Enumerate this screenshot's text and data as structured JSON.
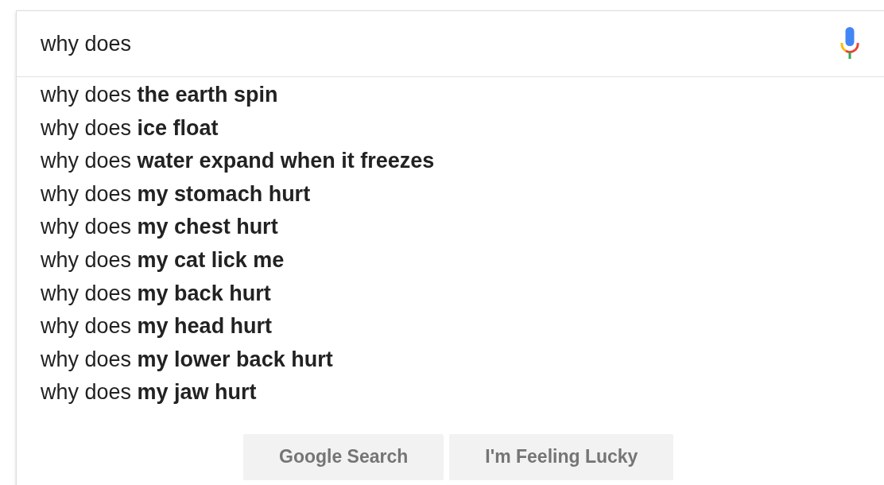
{
  "search": {
    "value": "why does"
  },
  "suggestions": [
    "why does **the earth spin**",
    "why does **ice float**",
    "why does **water expand when it freezes**",
    "why does **my stomach hurt**",
    "why does **my chest hurt**",
    "why does **my cat lick me**",
    "why does **my back hurt**",
    "why does **my head hurt**",
    "why does **my lower back hurt**",
    "why does **my jaw hurt**"
  ],
  "buttons": [
    "Google Search",
    "I'm Feeling Lucky"
  ]
}
